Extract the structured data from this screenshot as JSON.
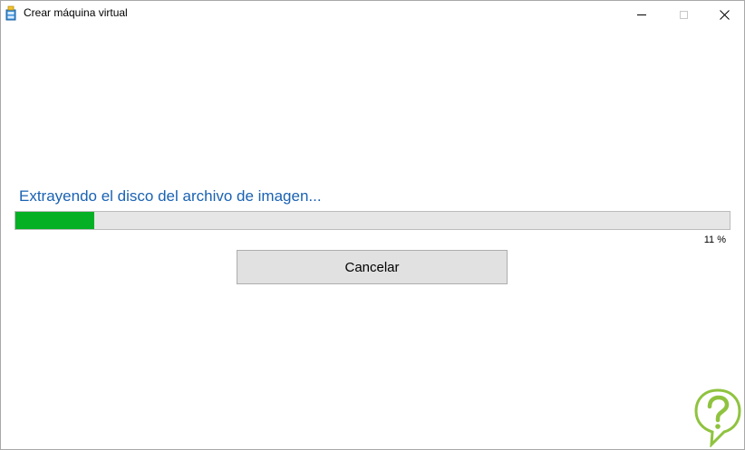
{
  "window": {
    "title": "Crear máquina virtual"
  },
  "titlebar_icons": {
    "app": "vm-wizard-icon",
    "minimize": "minimize-icon",
    "maximize": "maximize-icon",
    "close": "close-icon"
  },
  "status": {
    "message": "Extrayendo el disco del archivo de imagen...",
    "progress_percent": 11,
    "percent_label": "11 %"
  },
  "actions": {
    "cancel_label": "Cancelar"
  },
  "colors": {
    "status_text": "#1a62b3",
    "progress_fill": "#06b025",
    "progress_track": "#e6e6e6",
    "button_bg": "#e1e1e1",
    "watermark": "#8fc33f"
  },
  "watermark": {
    "icon": "question-mark-logo-icon"
  }
}
